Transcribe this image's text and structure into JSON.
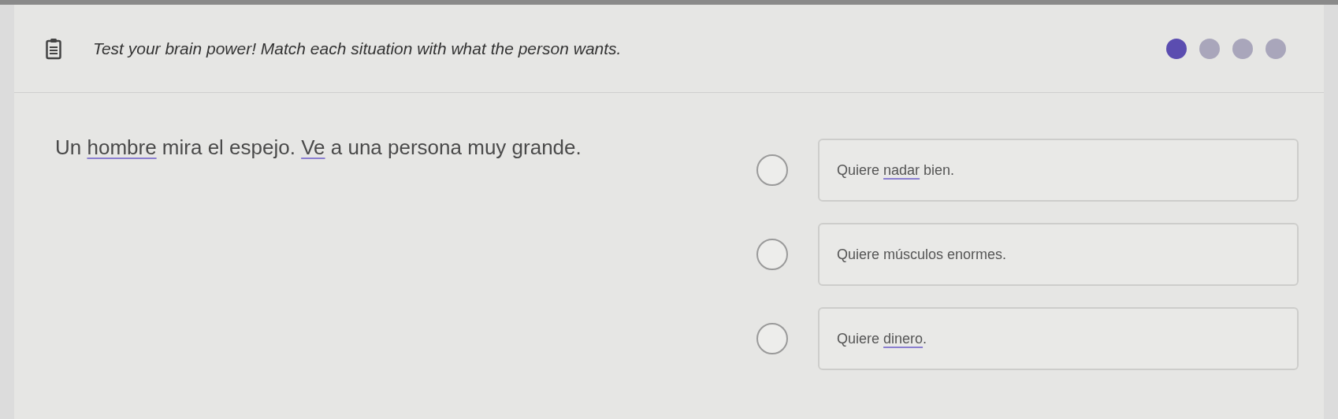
{
  "header": {
    "title": "Test your brain power! Match each situation with what the person wants.",
    "progress": [
      {
        "selected": true
      },
      {
        "selected": false
      },
      {
        "selected": false
      },
      {
        "selected": false
      }
    ]
  },
  "question": {
    "segments": [
      {
        "kind": "text",
        "text": "Un "
      },
      {
        "kind": "link",
        "text": "hombre"
      },
      {
        "kind": "text",
        "text": " mira el espejo. "
      },
      {
        "kind": "link",
        "text": "Ve"
      },
      {
        "kind": "text",
        "text": " a una persona muy grande."
      }
    ]
  },
  "options": [
    {
      "selected": false,
      "segments": [
        {
          "kind": "text",
          "text": "Quiere "
        },
        {
          "kind": "link",
          "text": "nadar"
        },
        {
          "kind": "text",
          "text": " bien."
        }
      ]
    },
    {
      "selected": false,
      "segments": [
        {
          "kind": "text",
          "text": "Quiere músculos enormes."
        }
      ]
    },
    {
      "selected": false,
      "segments": [
        {
          "kind": "text",
          "text": "Quiere "
        },
        {
          "kind": "link",
          "text": "dinero"
        },
        {
          "kind": "text",
          "text": "."
        }
      ]
    }
  ]
}
